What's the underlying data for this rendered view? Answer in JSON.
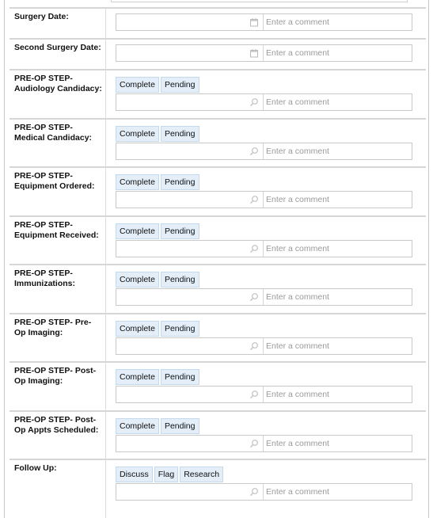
{
  "placeholder": "Enter a comment",
  "date_rows": [
    {
      "label": "Surgery Date:"
    },
    {
      "label": "Second Surgery Date:"
    }
  ],
  "status_rows": [
    {
      "label": "PRE-OP STEP- Audiology Candidacy:",
      "buttons": [
        "Complete",
        "Pending"
      ]
    },
    {
      "label": "PRE-OP STEP- Medical Candidacy:",
      "buttons": [
        "Complete",
        "Pending"
      ]
    },
    {
      "label": "PRE-OP STEP- Equipment Ordered:",
      "buttons": [
        "Complete",
        "Pending"
      ]
    },
    {
      "label": "PRE-OP STEP- Equipment Received:",
      "buttons": [
        "Complete",
        "Pending"
      ]
    },
    {
      "label": "PRE-OP STEP- Immunizations:",
      "buttons": [
        "Complete",
        "Pending"
      ]
    },
    {
      "label": "PRE-OP STEP- Pre-Op Imaging:",
      "buttons": [
        "Complete",
        "Pending"
      ]
    },
    {
      "label": "PRE-OP STEP- Post-Op Imaging:",
      "buttons": [
        "Complete",
        "Pending"
      ]
    },
    {
      "label": "PRE-OP STEP- Post-Op Appts Scheduled:",
      "buttons": [
        "Complete",
        "Pending"
      ]
    },
    {
      "label": "Follow Up:",
      "buttons": [
        "Discuss",
        "Flag",
        "Research"
      ]
    }
  ],
  "icons": {
    "date": "calendar-icon",
    "search": "search-icon"
  },
  "colors": {
    "button_bg": "#e3eef8",
    "button_border": "#c5d9ec"
  }
}
